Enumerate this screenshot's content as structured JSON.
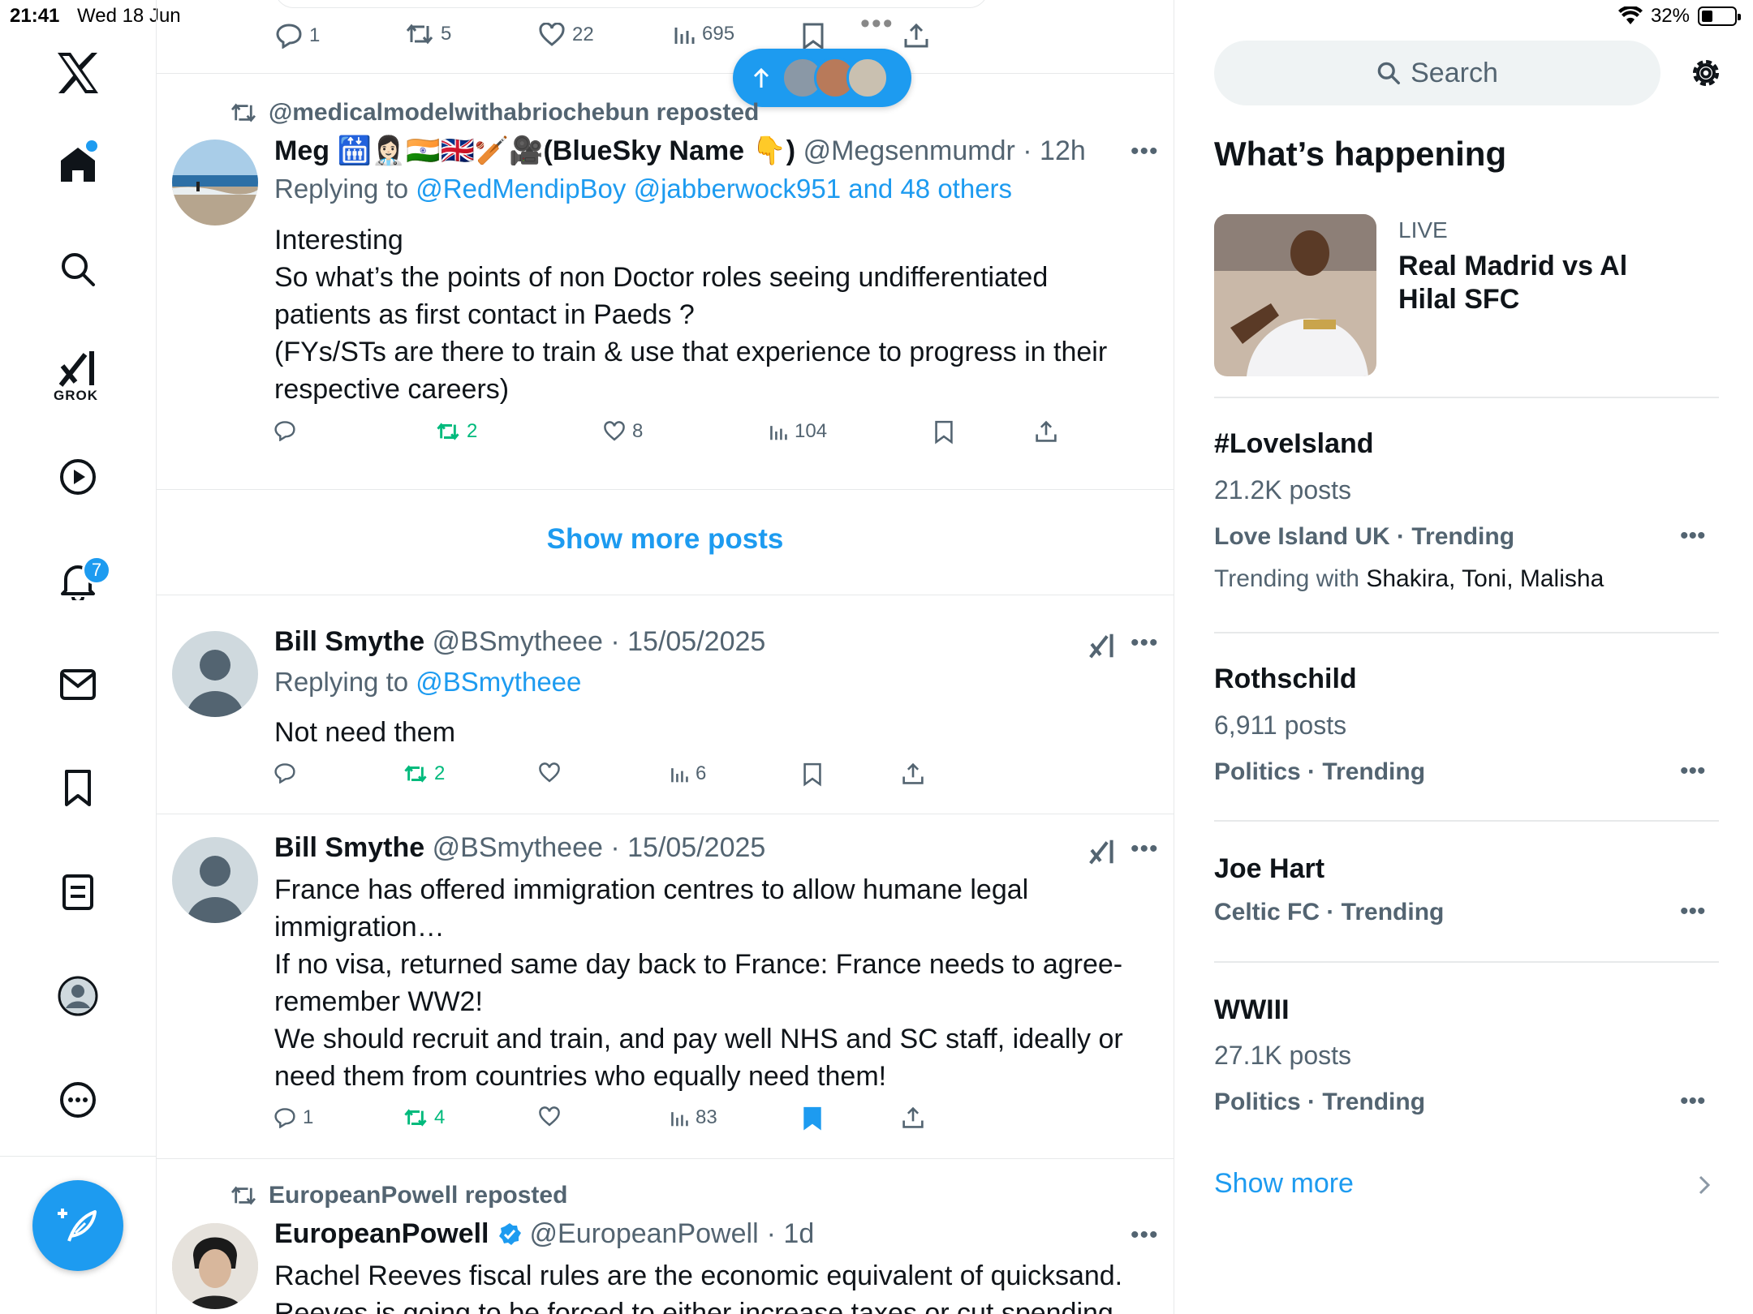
{
  "status_bar": {
    "time": "21:41",
    "date": "Wed 18 Jun",
    "battery": "32%",
    "battery_level": 0.32
  },
  "nav": {
    "notifications_count": "7",
    "grok_label": "GROK"
  },
  "top_tweet_actions": {
    "replies": "1",
    "reposts": "5",
    "likes": "22",
    "views": "695"
  },
  "tweet1": {
    "reposted_by": "@medicalmodelwithabriochebun reposted",
    "name": "Meg 🛗👩🏻‍⚕️🇮🇳🇬🇧🏏🎥(BlueSky Name 👇)",
    "handle": "@Megsenmumdr",
    "time": "· 12h",
    "replying_prefix": "Replying to",
    "replying_to": "@RedMendipBoy @jabberwock951 and 48 others",
    "text": "Interesting\nSo what’s the points of non Doctor roles seeing undifferentiated patients as first contact in Paeds ?\n(FYs/STs are there to train & use that experience to progress in their respective careers)",
    "reposts": "2",
    "likes": "8",
    "views": "104"
  },
  "show_more_posts": "Show more posts",
  "tweet2": {
    "name": "Bill Smythe",
    "handle": "@BSmytheee",
    "time": "· 15/05/2025",
    "replying_prefix": "Replying to",
    "replying_to": "@BSmytheee",
    "text": "Not need them",
    "reposts": "2",
    "views": "6"
  },
  "tweet3": {
    "name": "Bill Smythe",
    "handle": "@BSmytheee",
    "time": "· 15/05/2025",
    "text": "France has offered immigration centres to allow humane legal immigration…\nIf no visa, returned same day back to France: France needs to agree- remember WW2!\nWe should recruit and train, and pay well NHS and SC staff, ideally or need them from countries who equally need them!",
    "replies": "1",
    "reposts": "4",
    "views": "83"
  },
  "tweet4": {
    "reposted_by": "EuropeanPowell reposted",
    "name": "EuropeanPowell",
    "handle": "@EuropeanPowell",
    "time": "· 1d",
    "text": "Rachel Reeves fiscal rules are the economic equivalent of quicksand.\nReeves is going to be forced to either increase taxes or cut spending by"
  },
  "search": {
    "placeholder": "Search"
  },
  "whats_happening": {
    "title": "What’s happening",
    "live": {
      "label": "LIVE",
      "title": "Real Madrid vs Al Hilal SFC"
    },
    "trends": [
      {
        "title": "#LoveIsland",
        "posts": "21.2K posts",
        "context": "Love Island UK · Trending",
        "with_label": "Trending with",
        "with_names": "Shakira, Toni, Malisha"
      },
      {
        "title": "Rothschild",
        "posts": "6,911 posts",
        "context": "Politics · Trending"
      },
      {
        "title": "Joe Hart",
        "context": "Celtic FC · Trending"
      },
      {
        "title": "WWIII",
        "posts": "27.1K posts",
        "context": "Politics · Trending"
      }
    ],
    "show_more": "Show more"
  },
  "colors": {
    "accent": "#1d9bf0",
    "repost_green": "#00ba7c",
    "muted": "#536471",
    "text": "#0f1419",
    "divider": "#e7e9ea"
  }
}
